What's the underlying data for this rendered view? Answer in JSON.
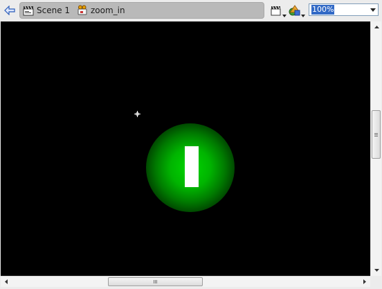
{
  "editbar": {
    "back_icon": "back-arrow-icon",
    "breadcrumb": [
      {
        "label": "Scene 1",
        "icon": "clapperboard-scene-icon"
      },
      {
        "label": "zoom_in",
        "icon": "movie-clip-symbol-icon"
      }
    ],
    "edit_scene_icon": "edit-scene-icon",
    "edit_symbol_icon": "edit-symbols-icon",
    "zoom": {
      "value": "100%"
    }
  },
  "stage": {
    "background": "#000000",
    "glow_color": "#00d600",
    "bar_color": "#ffffff"
  }
}
